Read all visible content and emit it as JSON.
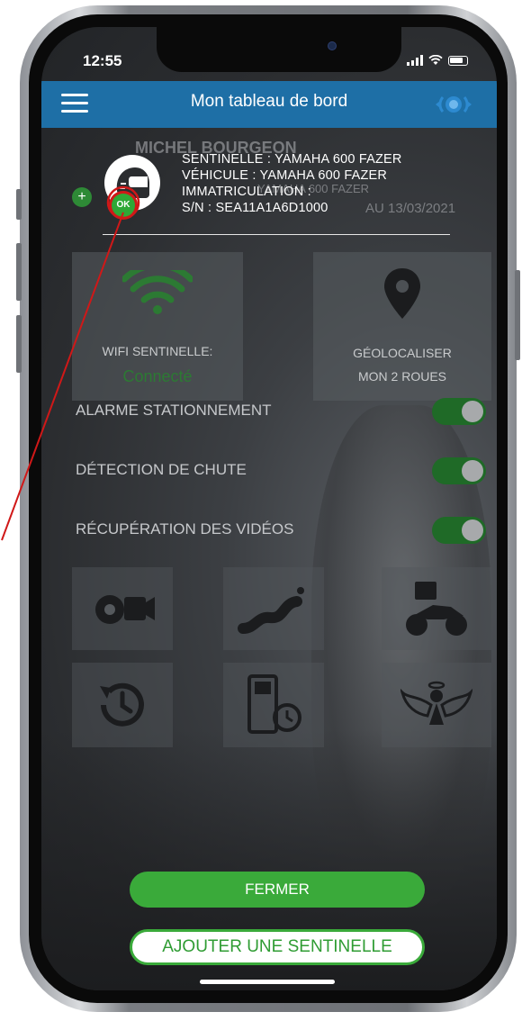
{
  "status_bar": {
    "time": "12:55"
  },
  "header": {
    "menu_icon": "hamburger-icon",
    "title": "Mon tableau de bord",
    "logo_icon": "sentinelle-logo-icon"
  },
  "background": {
    "name": "MICHEL BOURGEON",
    "line2": "YAMAHA 600 FAZER",
    "line3": "AU 13/03/2021"
  },
  "sentinel_popup": {
    "avatar_icon": "helmet-icon",
    "status_badge": "OK",
    "add_badge": "+",
    "sentinelle": "SENTINELLE : YAMAHA 600 FAZER",
    "vehicule": "VÉHICULE : YAMAHA 600 FAZER",
    "immatriculation": "IMMATRICULATION :",
    "serial": "S/N : SEA11A1A6D1000"
  },
  "tiles": {
    "wifi": {
      "label": "WIFI SENTINELLE:",
      "status": "Connecté",
      "icon": "wifi-icon"
    },
    "geo": {
      "label_line1": "GÉOLOCALISER",
      "label_line2": "MON 2 ROUES",
      "icon": "map-pin-icon"
    }
  },
  "toggles": [
    {
      "label": "ALARME STATIONNEMENT",
      "on": true
    },
    {
      "label": "DÉTECTION DE CHUTE",
      "on": true
    },
    {
      "label": "RÉCUPÉRATION DES VIDÉOS",
      "on": true
    }
  ],
  "icon_grid": [
    "camera-settings-icon",
    "route-icon",
    "video-motorcycle-icon",
    "history-icon",
    "fuel-timer-icon",
    "angel-icon"
  ],
  "buttons": {
    "close": "FERMER",
    "add": "AJOUTER UNE SENTINELLE"
  },
  "colors": {
    "header_blue": "#1e6fa6",
    "accent_green": "#3aaa3a",
    "annotation_red": "#d01818"
  }
}
